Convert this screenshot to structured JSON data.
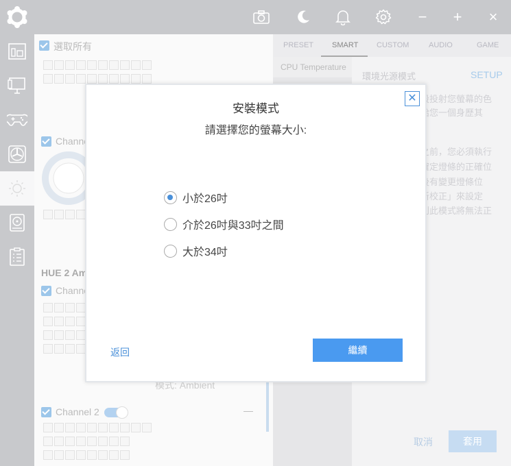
{
  "window": {
    "minimize_label": "−",
    "maximize_label": "+",
    "close_label": "×"
  },
  "toolbar": {
    "icons": [
      "camera-icon",
      "moon-icon",
      "bell-icon",
      "gear-icon"
    ]
  },
  "sidebar": {
    "items": [
      "lighting-devices-icon",
      "monitor-icon",
      "gamepad-icon",
      "fan-icon",
      "sun-icon",
      "hdd-icon",
      "clipboard-icon"
    ],
    "active_index": 4
  },
  "left_panel": {
    "select_all_label": "選取所有",
    "channel_label_1": "Channe",
    "heading": "HUE 2 Am",
    "channel_label_2": "Channe",
    "mode_label": "模式: Ambient",
    "channel2_label": "Channel 2",
    "collapse_label": "—"
  },
  "right_panel": {
    "tabs": [
      "PRESET",
      "SMART",
      "CUSTOM",
      "AUDIO",
      "GAME"
    ],
    "active_tab": 1,
    "sub_item": "CPU Temperature",
    "mode_title": "環境光源模式",
    "setup_label": "SETUP",
    "desc_lines": [
      "設投射您螢幕的色",
      "給您一個身歷其"
    ],
    "desc_lines_2": [
      "之前，您必須執行",
      "確定燈條的正確位",
      "後有變更燈條位",
      "新校正」來設定",
      "則此模式將無法正"
    ],
    "cancel_label": "取消",
    "apply_label": "套用"
  },
  "dialog": {
    "title": "安裝模式",
    "subtitle": "請選擇您的螢幕大小:",
    "close_label": "✕",
    "options": [
      "小於26吋",
      "介於26吋與33吋之間",
      "大於34吋"
    ],
    "selected_index": 0,
    "back_label": "返回",
    "continue_label": "繼續"
  },
  "colors": {
    "accent": "#4a90d9",
    "continue_button": "#4a9af0",
    "chrome": "#c8c9cc"
  }
}
